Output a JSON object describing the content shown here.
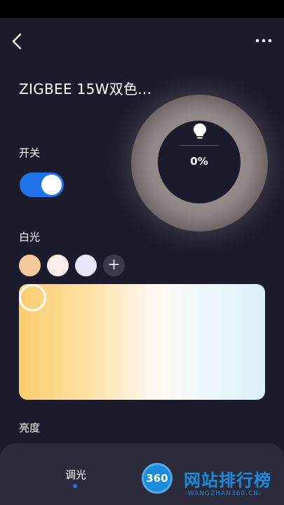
{
  "header": {
    "title": "ZIGBEE 15W双色..."
  },
  "lamp": {
    "brightness_text": "0%"
  },
  "power": {
    "label": "开关",
    "on": true
  },
  "white_light": {
    "label": "白光",
    "presets": [
      "#f6c99b",
      "#fbeeea",
      "#e7e7fb"
    ],
    "add_symbol": "+",
    "gradient_colors": [
      "#fbcc6e",
      "#fef4e6",
      "#dcf0fa"
    ]
  },
  "brightness": {
    "label": "亮度"
  },
  "tabs": [
    {
      "label": "调光",
      "active": true
    }
  ],
  "watermark": {
    "logo_text": "360",
    "main": "网站排行榜",
    "sub": "-WANGZHAN360.CN-"
  },
  "colors": {
    "background": "#1b1b2c",
    "accent": "#1e74e8"
  }
}
